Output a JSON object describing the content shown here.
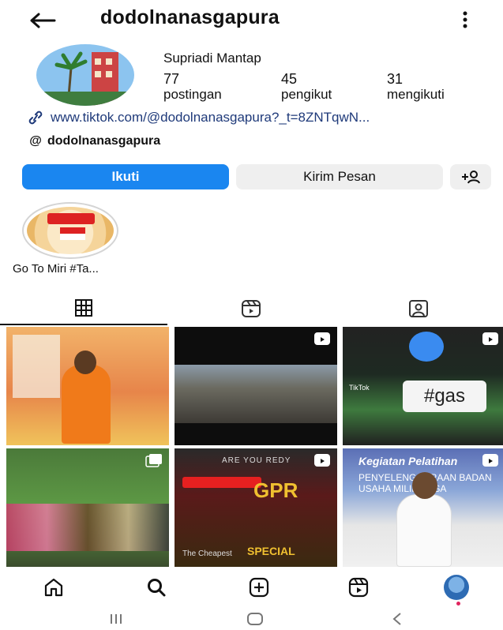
{
  "header": {
    "username": "dodolnanasgapura",
    "back_icon": "arrow-left-icon",
    "more_icon": "more-vertical-icon"
  },
  "profile": {
    "display_name": "Supriadi Mantap",
    "stats": [
      {
        "value": "77",
        "label": "postingan"
      },
      {
        "value": "45",
        "label": "pengikut"
      },
      {
        "value": "31",
        "label": "mengikuti"
      }
    ],
    "link": "www.tiktok.com/@dodolnanasgapura?_t=8ZNTqwN...",
    "threads": "dodolnanasgapura"
  },
  "actions": {
    "follow": "Ikuti",
    "message": "Kirim Pesan",
    "add_user_icon": "add-user-icon"
  },
  "highlights": [
    {
      "label": "Go To Miri #Ta..."
    }
  ],
  "tabs": [
    {
      "name": "grid",
      "icon": "grid-icon"
    },
    {
      "name": "reels",
      "icon": "reels-icon"
    },
    {
      "name": "tagged",
      "icon": "tagged-icon"
    }
  ],
  "grid_text": {
    "c3_tag": "#gas",
    "c3_tiktok": "TikTok",
    "c5_ready": "ARE YOU REDY",
    "c5_big": "GPR",
    "c5_special": "SPECIAL",
    "c5_cheap": "The Cheapest",
    "c6_title": "Kegiatan Pelatihan",
    "c6_sub": "PENYELENGGARAAN BADAN USAHA MILIK DESA"
  },
  "bottom_nav": [
    {
      "name": "home",
      "icon": "home-icon"
    },
    {
      "name": "search",
      "icon": "search-icon"
    },
    {
      "name": "create",
      "icon": "add-post-icon"
    },
    {
      "name": "reels",
      "icon": "reels-icon"
    },
    {
      "name": "profile",
      "icon": "profile-avatar"
    }
  ],
  "colors": {
    "accent": "#1a86f0",
    "link": "#1f3a7a",
    "secondary_button": "#efefef",
    "notification_dot": "#e0245e"
  }
}
